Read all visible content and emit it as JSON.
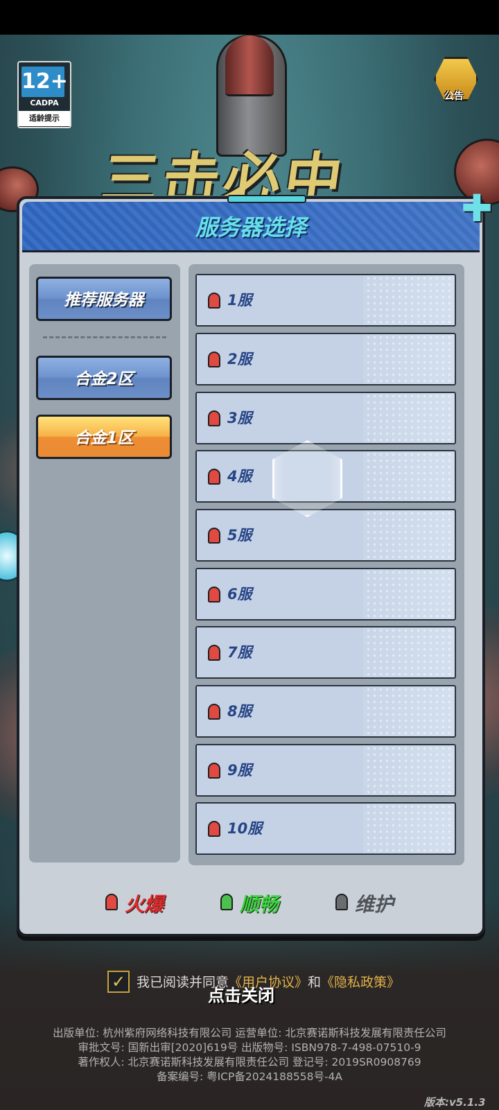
{
  "age_rating": {
    "number": "12+",
    "org": "CADPA",
    "tip": "适龄提示"
  },
  "announcement": {
    "label": "公告"
  },
  "game_logo_text": "三击必中",
  "dialog": {
    "title": "服务器选择",
    "zones": [
      {
        "label": "推荐服务器",
        "style": "blue"
      },
      {
        "label": "合金2区",
        "style": "blue"
      },
      {
        "label": "合金1区",
        "style": "orange",
        "selected": true
      }
    ],
    "servers": [
      {
        "name": "1服",
        "status": "火爆"
      },
      {
        "name": "2服",
        "status": "火爆"
      },
      {
        "name": "3服",
        "status": "火爆"
      },
      {
        "name": "4服",
        "status": "火爆"
      },
      {
        "name": "5服",
        "status": "火爆"
      },
      {
        "name": "6服",
        "status": "火爆"
      },
      {
        "name": "7服",
        "status": "火爆"
      },
      {
        "name": "8服",
        "status": "火爆"
      },
      {
        "name": "9服",
        "status": "火爆"
      },
      {
        "name": "10服",
        "status": "火爆"
      }
    ],
    "legend": [
      {
        "label": "火爆",
        "color": "#e04a43"
      },
      {
        "label": "顺畅",
        "color": "#4cc24e"
      },
      {
        "label": "维护",
        "color": "#6a6d70"
      }
    ]
  },
  "agreement": {
    "checked": true,
    "prefix": "我已阅读并同意",
    "user_agreement": "《用户协议》",
    "and": "和",
    "privacy_policy": "《隐私政策》"
  },
  "close_hint": "点击关闭",
  "footer": {
    "line1": "出版单位: 杭州紫府网络科技有限公司   运营单位: 北京赛诺斯科技发展有限责任公司",
    "line2": "审批文号: 国新出审[2020]619号   出版物号: ISBN978-7-498-07510-9",
    "line3": "著作权人: 北京赛诺斯科技发展有限责任公司   登记号: 2019SR0908769",
    "line4": "备案编号: 粤ICP备2024188558号-4A"
  },
  "version": "版本:v5.1.3"
}
